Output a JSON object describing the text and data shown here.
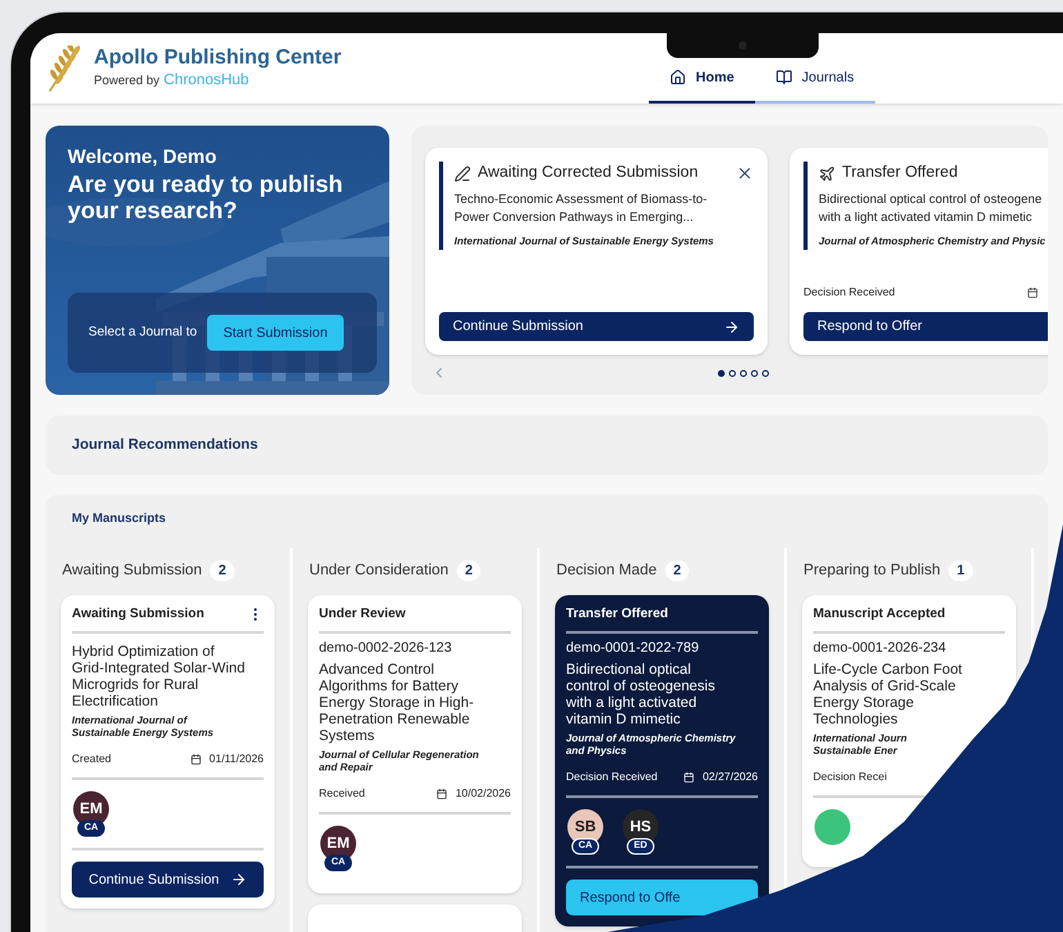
{
  "header": {
    "title": "Apollo Publishing Center",
    "powered_by": "Powered by",
    "brand": "ChronosHub",
    "nav": [
      {
        "kind": "home",
        "label": "Home",
        "selected": true
      },
      {
        "kind": "journals",
        "label": "Journals",
        "selected": false
      }
    ]
  },
  "hero": {
    "greeting": "Welcome, Demo",
    "headline": "Are you ready to publish your research?",
    "prompt": "Select a Journal to",
    "button": "Start Submission"
  },
  "carousel": {
    "cards": [
      {
        "kind": "edit",
        "title": "Awaiting Corrected Submission",
        "dismissible": true,
        "description_lines": [
          "Techno-Economic Assessment of Biomass-to-",
          "Power Conversion Pathways in Emerging..."
        ],
        "journal": "International Journal of Sustainable Energy Systems",
        "button": "Continue Submission"
      },
      {
        "kind": "transfer",
        "title": "Transfer Offered",
        "description_lines": [
          "Bidirectional optical control of osteogene",
          "with a light activated vitamin D mimetic"
        ],
        "journal": "Journal of Atmospheric Chemistry and Physic",
        "event": "Decision Received",
        "button": "Respond to Offer"
      }
    ],
    "dots": [
      {
        "selected": true
      },
      {
        "selected": false
      },
      {
        "selected": false
      },
      {
        "selected": false
      },
      {
        "selected": false
      }
    ]
  },
  "recommendations": {
    "title": "Journal Recommendations"
  },
  "manuscripts": {
    "title": "My Manuscripts",
    "columns": [
      {
        "title": "Awaiting Submission",
        "count": "2",
        "cards": [
          {
            "kind": "full",
            "status": "Awaiting Submission",
            "menu": true,
            "highlighted": false,
            "title_lines": [
              "Hybrid Optimization of",
              "Grid-Integrated Solar-Wind",
              "Microgrids for Rural",
              "Electrification"
            ],
            "journal_lines": [
              "International Journal of",
              "Sustainable Energy Systems"
            ],
            "event": "Created",
            "date": "01/11/2026",
            "people": [
              {
                "initials": "EM",
                "role": "CA",
                "color": "#4a2432"
              }
            ],
            "button": "Continue Submission"
          }
        ]
      },
      {
        "title": "Under Consideration",
        "count": "2",
        "cards": [
          {
            "kind": "full",
            "status": "Under Review",
            "menu": false,
            "highlighted": false,
            "id": "demo-0002-2026-123",
            "title_lines": [
              "Advanced Control",
              "Algorithms for Battery",
              "Energy Storage in High-",
              "Penetration Renewable",
              "Systems"
            ],
            "journal_lines": [
              "Journal of Cellular Regeneration",
              "and Repair"
            ],
            "event": "Received",
            "date": "10/02/2026",
            "people": [
              {
                "initials": "EM",
                "role": "CA",
                "color": "#4a2432"
              }
            ]
          },
          {
            "kind": "stub"
          }
        ]
      },
      {
        "title": "Decision Made",
        "count": "2",
        "cards": [
          {
            "kind": "full",
            "status": "Transfer Offered",
            "menu": false,
            "highlighted": true,
            "id": "demo-0001-2022-789",
            "title_lines": [
              "Bidirectional optical",
              "control of osteogenesis",
              "with a light activated",
              "vitamin D mimetic"
            ],
            "journal_lines": [
              "Journal of Atmospheric Chemistry",
              "and Physics"
            ],
            "event": "Decision Received",
            "date": "02/27/2026",
            "people": [
              {
                "initials": "SB",
                "role": "CA",
                "color": "#e9c6b8"
              },
              {
                "initials": "HS",
                "role": "ED",
                "color": "#262626"
              }
            ],
            "button": "Respond to Offe"
          }
        ]
      },
      {
        "title": "Preparing to Publish",
        "count": "1",
        "cards": [
          {
            "kind": "full",
            "status": "Manuscript Accepted",
            "menu": false,
            "highlighted": false,
            "id": "demo-0001-2026-234",
            "title_lines": [
              "Life-Cycle Carbon Foot",
              "Analysis of Grid-Scale",
              "Energy Storage",
              "Technologies"
            ],
            "journal_lines": [
              "International Journ",
              "Sustainable Ener"
            ],
            "event": "Decision Recei",
            "people": [
              {
                "color": "#3cc47c"
              }
            ]
          }
        ]
      }
    ]
  }
}
